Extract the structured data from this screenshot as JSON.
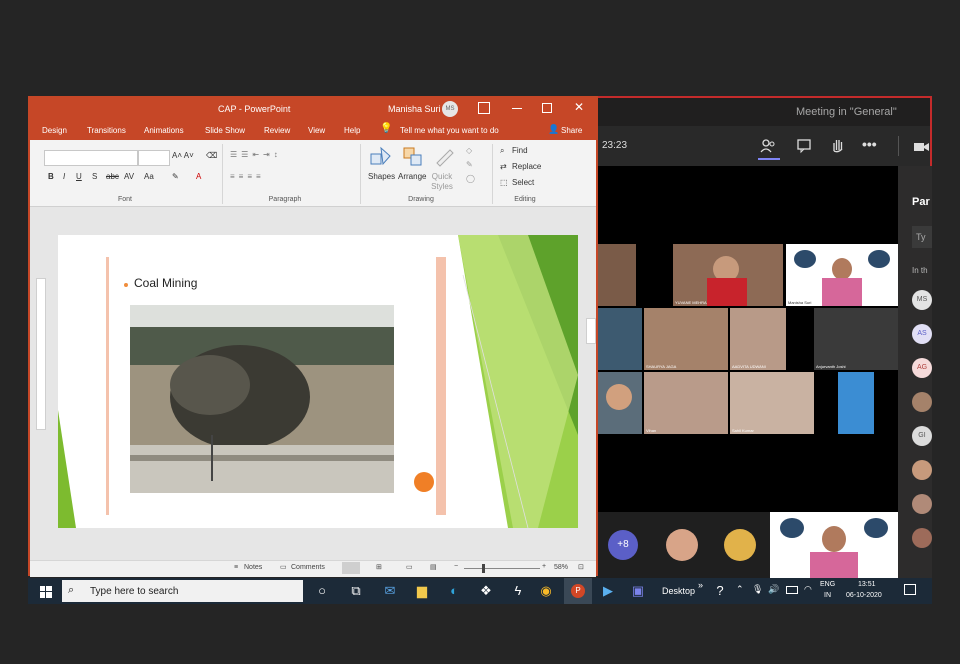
{
  "ppt": {
    "title": "CAP - PowerPoint",
    "user_name": "Manisha Suri",
    "user_initials": "MS",
    "menu": [
      "Design",
      "Transitions",
      "Animations",
      "Slide Show",
      "Review",
      "View",
      "Help"
    ],
    "tell_me": "Tell me what you want to do",
    "share": "Share",
    "groups": {
      "font": "Font",
      "paragraph": "Paragraph",
      "drawing": "Drawing",
      "editing": "Editing"
    },
    "drawing_buttons": [
      "Shapes",
      "Arrange",
      "Quick Styles"
    ],
    "editing_buttons": [
      "Find",
      "Replace",
      "Select"
    ],
    "slide_bullet": "Coal Mining",
    "status": {
      "notes": "Notes",
      "comments": "Comments",
      "zoom": "58%"
    },
    "accent": "#c64727"
  },
  "teams": {
    "title": "Meeting in \"General\"",
    "timer": "23:23",
    "participant_head": "Par",
    "search_stub": "Ty",
    "section_stub": "In th",
    "avatar_stubs": [
      "MS",
      "AS",
      "AG",
      "GI"
    ],
    "more_count": "+8",
    "tile_names": [
      "YUVANE MEHRA",
      "Manisha Suri",
      "SHAURYA JAGA",
      "AADVITA UDWANI",
      "Anjurvanth Joshi",
      "Vihan",
      "Sahil Kumar"
    ]
  },
  "taskbar": {
    "search_placeholder": "Type here to search",
    "desktop": "Desktop",
    "lang": "ENG",
    "region": "IN",
    "time": "13:51",
    "date": "06-10-2020"
  }
}
